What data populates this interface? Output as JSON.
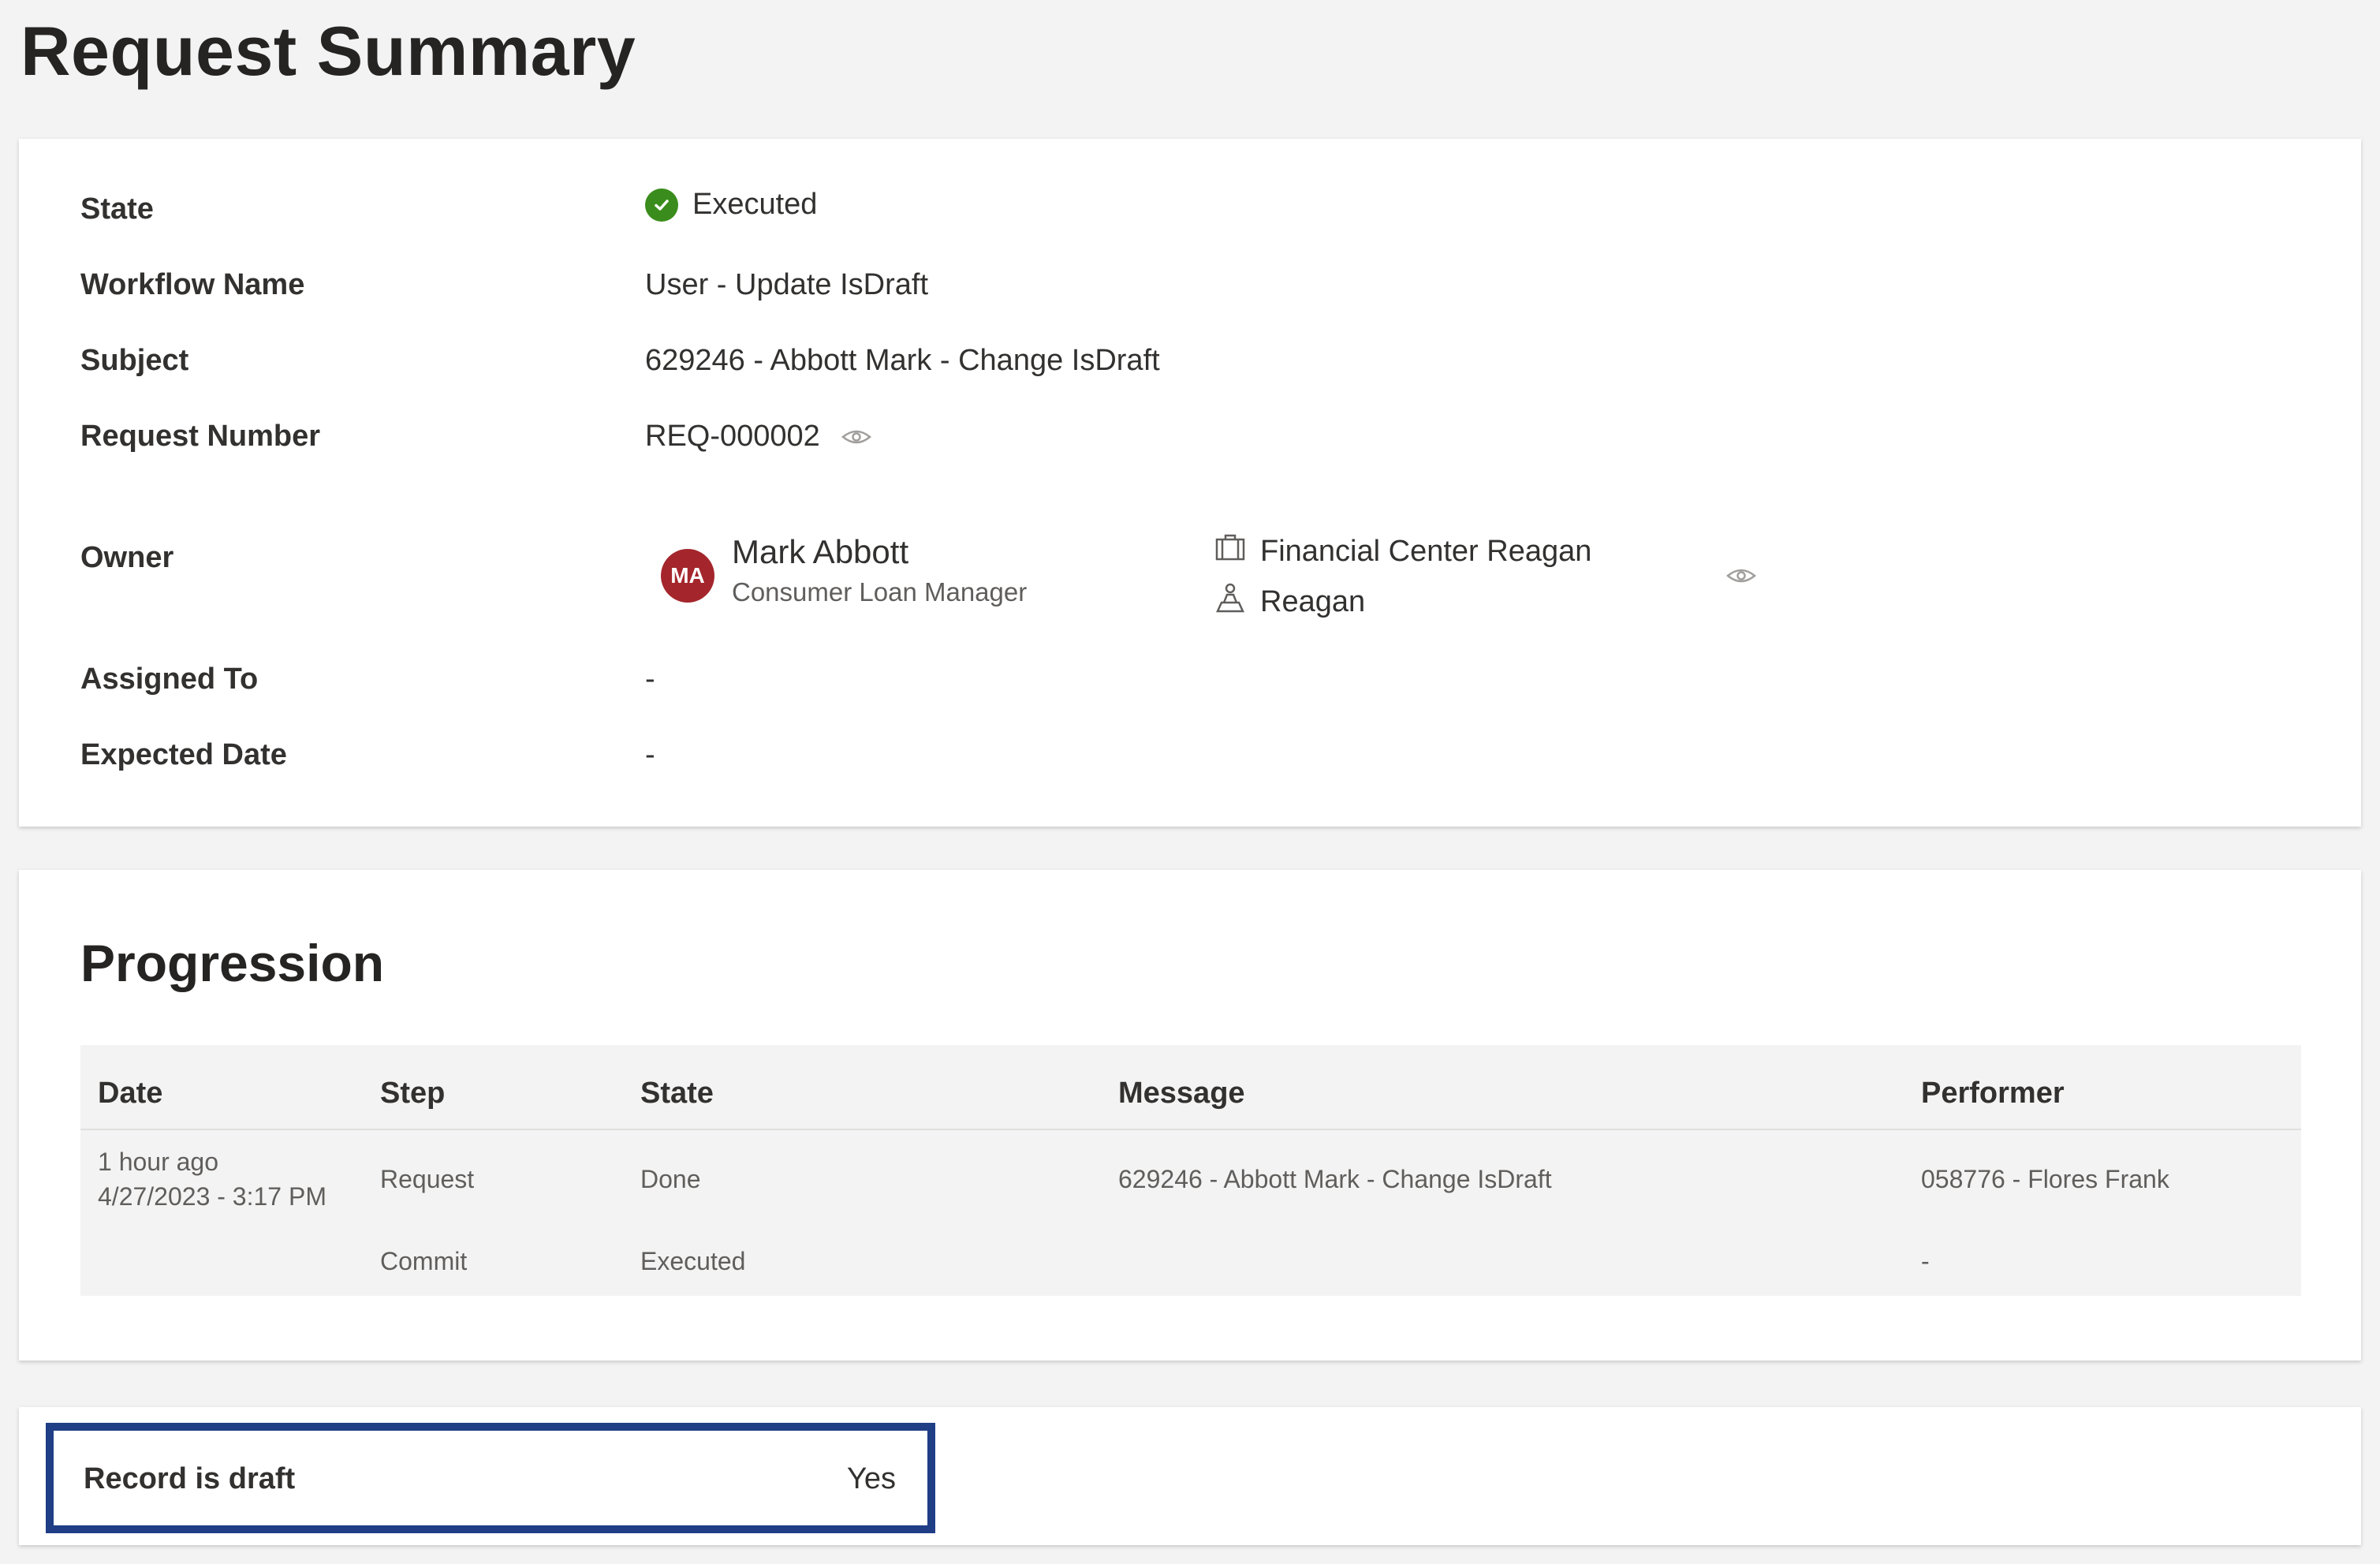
{
  "page": {
    "title": "Request Summary"
  },
  "summary": {
    "state_label": "State",
    "state_value": "Executed",
    "workflow_label": "Workflow Name",
    "workflow_value": "User - Update IsDraft",
    "subject_label": "Subject",
    "subject_value": "629246 - Abbott Mark - Change IsDraft",
    "request_number_label": "Request Number",
    "request_number_value": "REQ-000002",
    "owner_label": "Owner",
    "owner": {
      "initials": "MA",
      "name": "Mark Abbott",
      "role": "Consumer Loan Manager",
      "organization": "Financial Center Reagan",
      "location": "Reagan"
    },
    "assigned_label": "Assigned To",
    "assigned_value": "-",
    "expected_label": "Expected Date",
    "expected_value": "-"
  },
  "progression": {
    "title": "Progression",
    "columns": [
      "Date",
      "Step",
      "State",
      "Message",
      "Performer"
    ],
    "rows": [
      {
        "date_relative": "1 hour ago",
        "date": "4/27/2023 - 3:17 PM",
        "step": "Request",
        "state": "Done",
        "message": "629246 - Abbott Mark - Change IsDraft",
        "performer": "058776 - Flores Frank"
      },
      {
        "date_relative": "",
        "date": "",
        "step": "Commit",
        "state": "Executed",
        "message": "",
        "performer": "-"
      }
    ]
  },
  "record": {
    "label": "Record is draft",
    "value": "Yes"
  },
  "colors": {
    "success": "#3a8d1c",
    "avatar": "#a4262c",
    "highlight_border": "#1f3e86"
  },
  "icons": [
    "check-circle-icon",
    "eye-icon",
    "briefcase-icon",
    "location-person-icon"
  ]
}
